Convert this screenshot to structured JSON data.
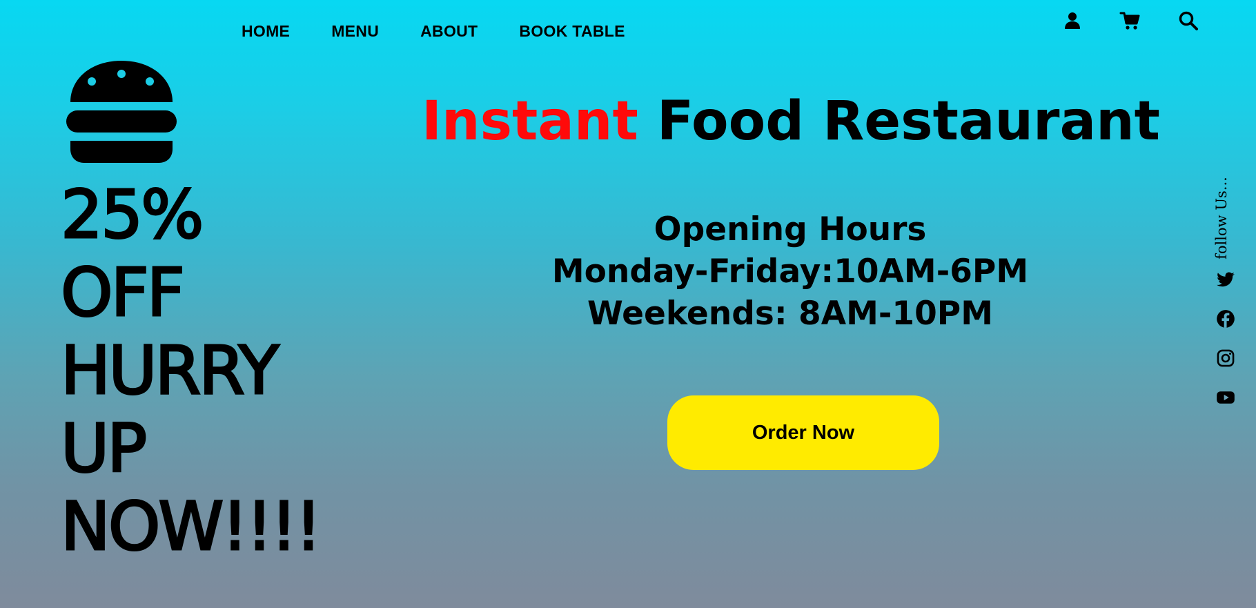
{
  "nav": {
    "items": [
      {
        "label": "HOME"
      },
      {
        "label": "MENU"
      },
      {
        "label": "ABOUT"
      },
      {
        "label": "BOOK TABLE"
      }
    ]
  },
  "header_icons": [
    "user-icon",
    "cart-icon",
    "search-icon"
  ],
  "promo": {
    "lines": [
      "25%",
      "OFF",
      "HURRY",
      "UP",
      "NOW!!!!"
    ],
    "icon": "burger-icon"
  },
  "hero": {
    "title_accent": "Instant",
    "title_rest": "Food Restaurant",
    "accent_color": "#ff0a0a",
    "hours_heading": "Opening Hours",
    "hours_weekdays": "Monday-Friday:10AM-6PM",
    "hours_weekends": "Weekends: 8AM-10PM",
    "order_button": "Order Now",
    "button_color": "#ffeb00"
  },
  "social": {
    "follow_label": "follow Us...",
    "icons": [
      "twitter-icon",
      "facebook-icon",
      "instagram-icon",
      "youtube-icon"
    ]
  }
}
